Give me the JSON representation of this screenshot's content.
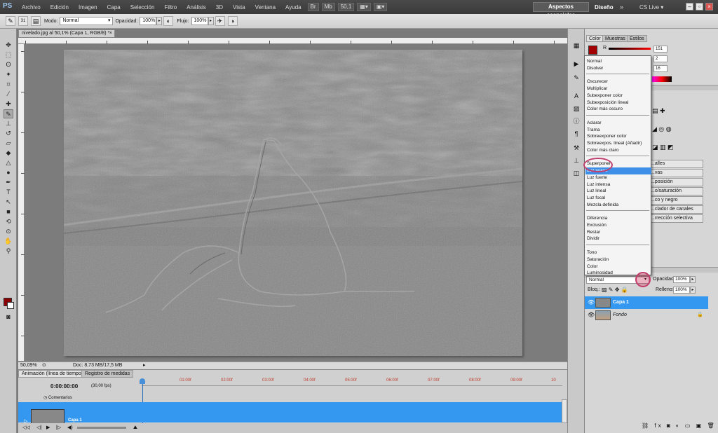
{
  "app": {
    "logo": "PS"
  },
  "menu": [
    "Archivo",
    "Edición",
    "Imagen",
    "Capa",
    "Selección",
    "Filtro",
    "Análisis",
    "3D",
    "Vista",
    "Ventana",
    "Ayuda"
  ],
  "zoom_menu": "50,1",
  "workspace": {
    "active": "Aspectos esenciales",
    "other": "Diseño",
    "more": "»",
    "cslive": "CS Live"
  },
  "options": {
    "brush_size": "31",
    "mode_label": "Modo:",
    "mode_value": "Normal",
    "opacity_label": "Opacidad:",
    "opacity_value": "100%",
    "flow_label": "Flujo:",
    "flow_value": "100%"
  },
  "document": {
    "tab": "nivelado.jpg al 50,1% (Capa 1, RGB/8) *",
    "zoom": "50,09%",
    "doc_info": "Doc: 8,73 MB/17,5 MB"
  },
  "animation": {
    "tabs": [
      "Animación (línea de tiempo)",
      "Registro de medidas"
    ],
    "time": "0:00:00:00",
    "fps": "(30,00 fps)",
    "ticks": [
      "01:00f",
      "02:00f",
      "03:00f",
      "04:00f",
      "05:00f",
      "06:00f",
      "07:00f",
      "08:00f",
      "09:00f",
      "10"
    ],
    "comments": "Comentarios",
    "layer": "Capa 1"
  },
  "color_panel": {
    "tabs": [
      "Color",
      "Muestras",
      "Estilos"
    ],
    "r_label": "R",
    "r": "151",
    "g": "2",
    "b": "16",
    "fg_color": "#a50000"
  },
  "adjustments": {
    "items": [
      "...alles",
      "...vas",
      "...posición",
      "...o/saturación",
      "...co y negro",
      "...clador de canales",
      "...rrección selectiva"
    ]
  },
  "blend_menu": {
    "groups": [
      [
        "Normal",
        "Disolver"
      ],
      [
        "Oscurecer",
        "Multiplicar",
        "Subexponer color",
        "Subexposición lineal",
        "Color más oscuro"
      ],
      [
        "Aclarar",
        "Trama",
        "Sobreexponer color",
        "Sobreexpos. lineal (Añadir)",
        "Color más claro"
      ],
      [
        "Superponer",
        "Luz suave",
        "Luz fuerte",
        "Luz intensa",
        "Luz lineal",
        "Luz focal",
        "Mezcla definida"
      ],
      [
        "Diferencia",
        "Exclusión",
        "Restar",
        "Dividir"
      ],
      [
        "Tono",
        "Saturación",
        "Color",
        "Luminosidad"
      ]
    ],
    "highlighted": "Luz suave"
  },
  "layers_panel": {
    "blend_mode": "Normal",
    "opacity_label": "Opacidad:",
    "opacity": "100%",
    "lock_label": "Bloq.:",
    "fill_label": "Relleno:",
    "fill": "100%",
    "layers": [
      {
        "name": "Capa 1",
        "selected": true
      },
      {
        "name": "Fondo",
        "selected": false
      }
    ]
  }
}
